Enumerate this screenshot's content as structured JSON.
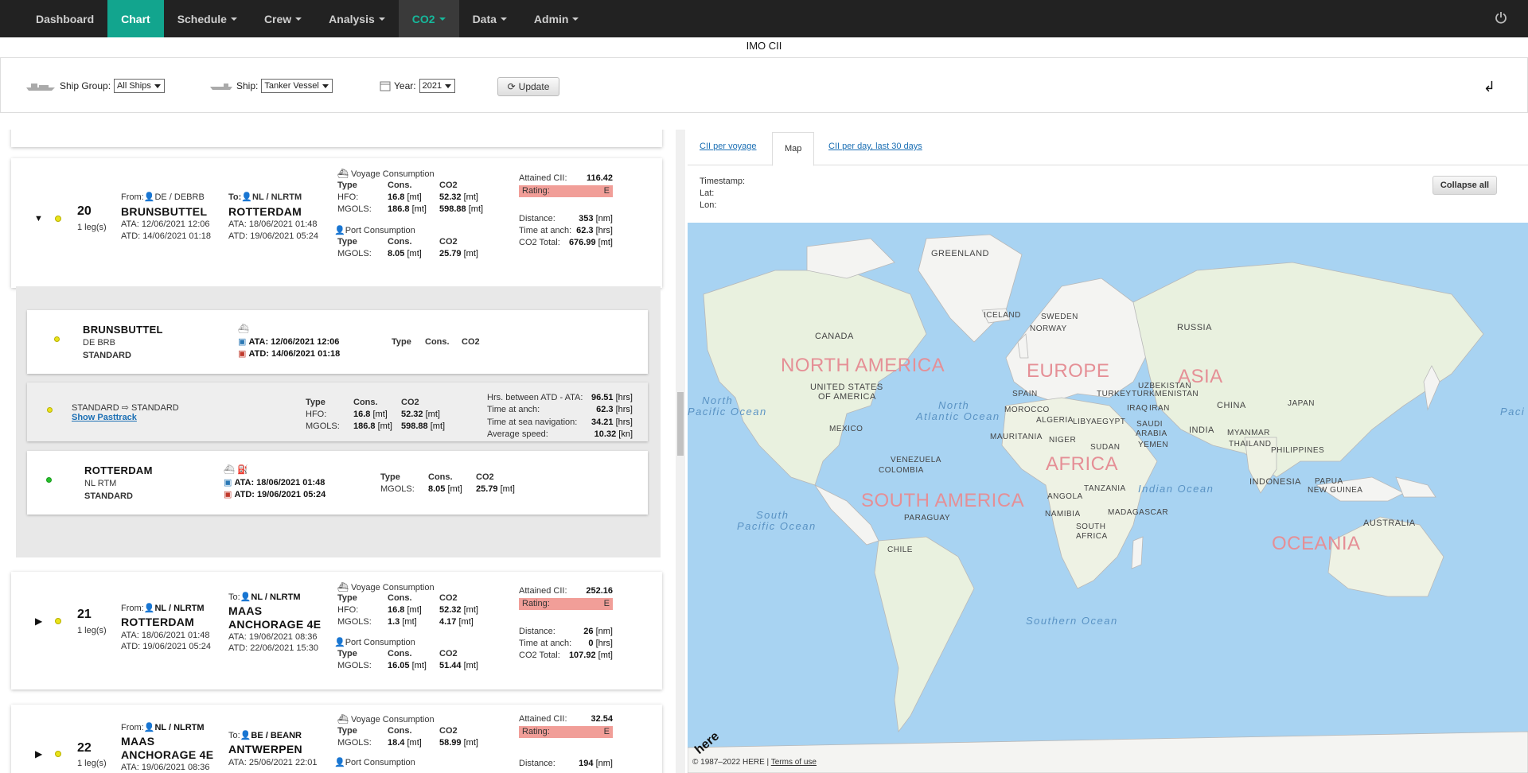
{
  "nav": {
    "items": [
      {
        "label": "Dashboard"
      },
      {
        "label": "Chart"
      },
      {
        "label": "Schedule"
      },
      {
        "label": "Crew"
      },
      {
        "label": "Analysis"
      },
      {
        "label": "CO2"
      },
      {
        "label": "Data"
      },
      {
        "label": "Admin"
      }
    ]
  },
  "page_title": "IMO CII",
  "filters": {
    "ship_group_label": "Ship Group:",
    "ship_group_value": "All Ships",
    "ship_label": "Ship:",
    "ship_value": "Tanker Vessel",
    "year_label": "Year:",
    "year_value": "2021",
    "update_label": "Update"
  },
  "common": {
    "voyage_consumption": "Voyage Consumption",
    "port_consumption": "Port Consumption",
    "type": "Type",
    "cons": "Cons.",
    "co2": "CO2",
    "hfo": "HFO:",
    "mgols": "MGOLS:",
    "mt": "[mt]",
    "nm": "[nm]",
    "hrs": "[hrs]",
    "kn": "[kn]",
    "attained_cii": "Attained CII:",
    "rating": "Rating:",
    "distance": "Distance:",
    "time_at_anch": "Time at anch:",
    "co2_total": "CO2 Total:",
    "leg": "1 leg(s)",
    "from": "From:",
    "to": "To:"
  },
  "voyages": [
    {
      "no": "20",
      "from_code": "DE / DEBRB",
      "from_port": "BRUNSBUTTEL",
      "from_ata": "ATA: 12/06/2021 12:06",
      "from_atd": "ATD: 14/06/2021 01:18",
      "to_code": "NL / NLRTM",
      "to_port": "ROTTERDAM",
      "to_ata": "ATA: 18/06/2021 01:48",
      "to_atd": "ATD: 19/06/2021 05:24",
      "hfo_cons": "16.8",
      "hfo_co2": "52.32",
      "mgols_cons": "186.8",
      "mgols_co2": "598.88",
      "port_mgols_cons": "8.05",
      "port_mgols_co2": "25.79",
      "cii": "116.42",
      "rating": "E",
      "distance": "353",
      "anch": "62.3",
      "co2_total": "676.99"
    },
    {
      "no": "21",
      "from_code": "NL / NLRTM",
      "from_port": "ROTTERDAM",
      "from_ata": "ATA: 18/06/2021 01:48",
      "from_atd": "ATD: 19/06/2021 05:24",
      "to_code": "NL / NLRTM",
      "to_port": "MAAS",
      "to_port2": "ANCHORAGE 4E",
      "to_ata": "ATA: 19/06/2021 08:36",
      "to_atd": "ATD: 22/06/2021 15:30",
      "hfo_cons": "16.8",
      "hfo_co2": "52.32",
      "mgols_cons": "1.3",
      "mgols_co2": "4.17",
      "port_mgols_cons": "16.05",
      "port_mgols_co2": "51.44",
      "cii": "252.16",
      "rating": "E",
      "distance": "26",
      "anch": "0",
      "co2_total": "107.92"
    },
    {
      "no": "22",
      "from_code": "NL / NLRTM",
      "from_port": "MAAS",
      "from_port2": "ANCHORAGE 4E",
      "from_ata": "ATA: 19/06/2021 08:36",
      "to_code": "BE / BEANR",
      "to_port": "ANTWERPEN",
      "to_ata": "ATA: 25/06/2021 22:01",
      "mgols_cons": "18.4",
      "mgols_co2": "58.99",
      "cii": "32.54",
      "rating": "E",
      "distance": "194"
    }
  ],
  "legs": {
    "port1": {
      "name": "BRUNSBUTTEL",
      "code": "DE BRB",
      "kind": "STANDARD",
      "ata": "ATA: 12/06/2021 12:06",
      "atd": "ATD: 14/06/2021 01:18"
    },
    "transit": {
      "label": "STANDARD ⇨ STANDARD",
      "link": "Show Pasttrack",
      "between": "Hrs. between ATD - ATA:",
      "between_v": "96.51",
      "anch": "Time at anch:",
      "anch_v": "62.3",
      "sea": "Time at sea navigation:",
      "sea_v": "34.21",
      "speed": "Average speed:",
      "speed_v": "10.32",
      "hfo_cons": "16.8",
      "hfo_co2": "52.32",
      "mgols_cons": "186.8",
      "mgols_co2": "598.88"
    },
    "port2": {
      "name": "ROTTERDAM",
      "code": "NL RTM",
      "kind": "STANDARD",
      "ata": "ATA: 18/06/2021 01:48",
      "atd": "ATD: 19/06/2021 05:24",
      "mgols_cons": "8.05",
      "mgols_co2": "25.79"
    }
  },
  "right": {
    "tabs": [
      "CII per voyage",
      "Map",
      "CII per day, last 30 days"
    ],
    "timestamp": "Timestamp:",
    "lat": "Lat:",
    "lon": "Lon:",
    "collapse": "Collapse all"
  },
  "map": {
    "countries": [
      "GREENLAND",
      "ICELAND",
      "SWEDEN",
      "NORWAY",
      "RUSSIA",
      "CANADA",
      "UNITED STATES",
      "OF AMERICA",
      "MEXICO",
      "VENEZUELA",
      "COLOMBIA",
      "PARAGUAY",
      "CHILE",
      "SPAIN",
      "MOROCCO",
      "ALGERIA",
      "LIBYA",
      "EGYPT",
      "MAURITANIA",
      "NIGER",
      "SUDAN",
      "SAUDI",
      "ARABIA",
      "YEMEN",
      "TURKEY",
      "TURKMENISTAN",
      "UZBEKISTAN",
      "IRAQ",
      "IRAN",
      "INDIA",
      "CHINA",
      "JAPAN",
      "MYANMAR",
      "THAILAND",
      "PHILIPPINES",
      "INDONESIA",
      "PAPUA",
      "NEW GUINEA",
      "TANZANIA",
      "ANGOLA",
      "NAMIBIA",
      "MADAGASCAR",
      "SOUTH",
      "AFRICA",
      "AUSTRALIA"
    ],
    "continents": [
      "NORTH AMERICA",
      "EUROPE",
      "ASIA",
      "AFRICA",
      "SOUTH AMERICA",
      "OCEANIA"
    ],
    "oceans": [
      "North",
      "Pacific Ocean",
      "North",
      "Atlantic Ocean",
      "Indian Ocean",
      "South",
      "Pacific Ocean",
      "Southern Ocean",
      "Paci"
    ],
    "copyright": "© 1987–2022 HERE |",
    "terms": "Terms of use",
    "logo": "here"
  }
}
